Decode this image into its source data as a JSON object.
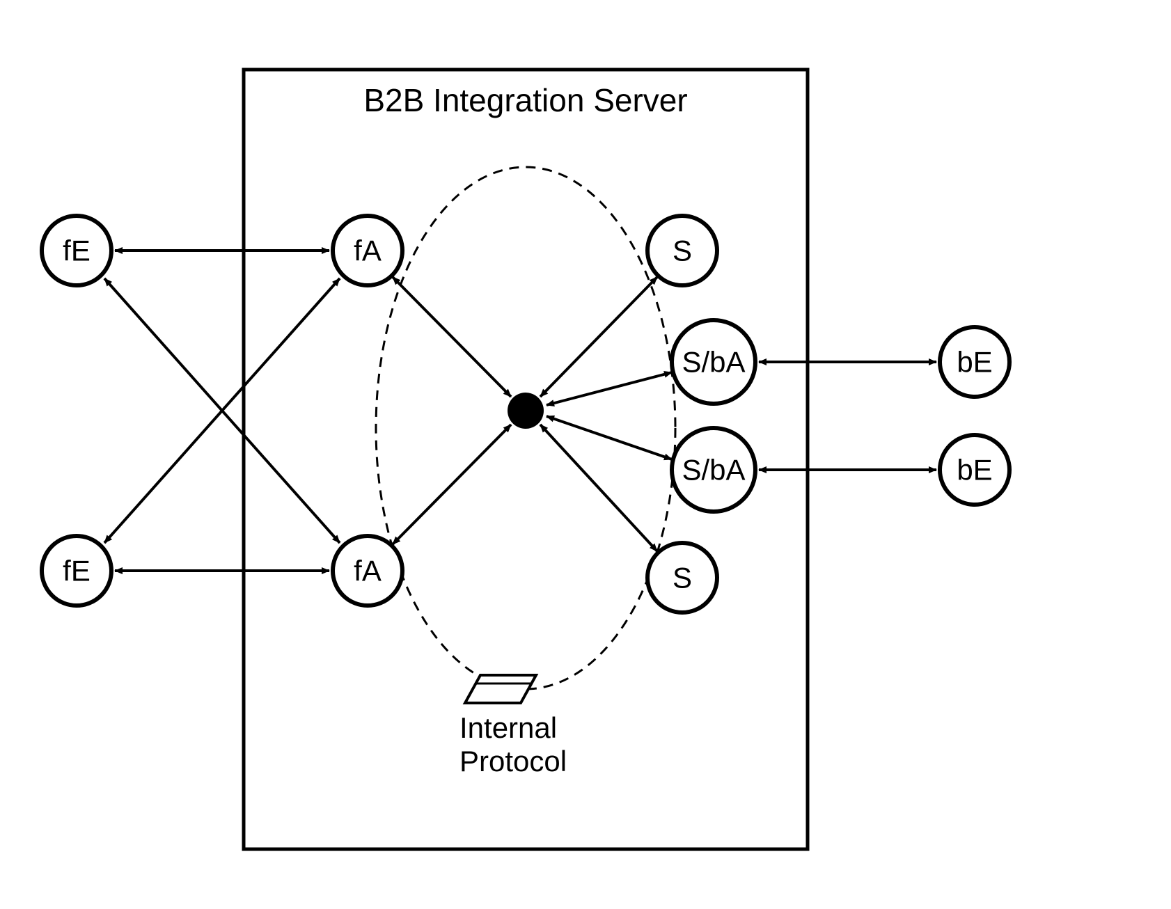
{
  "diagram": {
    "title": "B2B Integration Server",
    "internalProtocolLabel1": "Internal",
    "internalProtocolLabel2": "Protocol",
    "nodes": {
      "fe1": "fE",
      "fe2": "fE",
      "fa1": "fA",
      "fa2": "fA",
      "s1": "S",
      "s2": "S",
      "sba1": "S/bA",
      "sba2": "S/bA",
      "be1": "bE",
      "be2": "bE"
    },
    "structure": {
      "externalLeft": [
        "fE",
        "fE"
      ],
      "frontAdapters": [
        "fA",
        "fA"
      ],
      "services": [
        "S",
        "S/bA",
        "S/bA",
        "S"
      ],
      "externalRight": [
        "bE",
        "bE"
      ],
      "hub": "central-router"
    },
    "edges": [
      {
        "from": "fe1",
        "to": "fa1",
        "dir": "both"
      },
      {
        "from": "fe1",
        "to": "fa2",
        "dir": "both"
      },
      {
        "from": "fe2",
        "to": "fa1",
        "dir": "both"
      },
      {
        "from": "fe2",
        "to": "fa2",
        "dir": "both"
      },
      {
        "from": "fa1",
        "to": "hub",
        "dir": "both"
      },
      {
        "from": "fa2",
        "to": "hub",
        "dir": "both"
      },
      {
        "from": "hub",
        "to": "s1",
        "dir": "both"
      },
      {
        "from": "hub",
        "to": "s2",
        "dir": "both"
      },
      {
        "from": "hub",
        "to": "sba1",
        "dir": "both"
      },
      {
        "from": "hub",
        "to": "sba2",
        "dir": "both"
      },
      {
        "from": "sba1",
        "to": "be1",
        "dir": "both"
      },
      {
        "from": "sba2",
        "to": "be2",
        "dir": "both"
      }
    ]
  }
}
